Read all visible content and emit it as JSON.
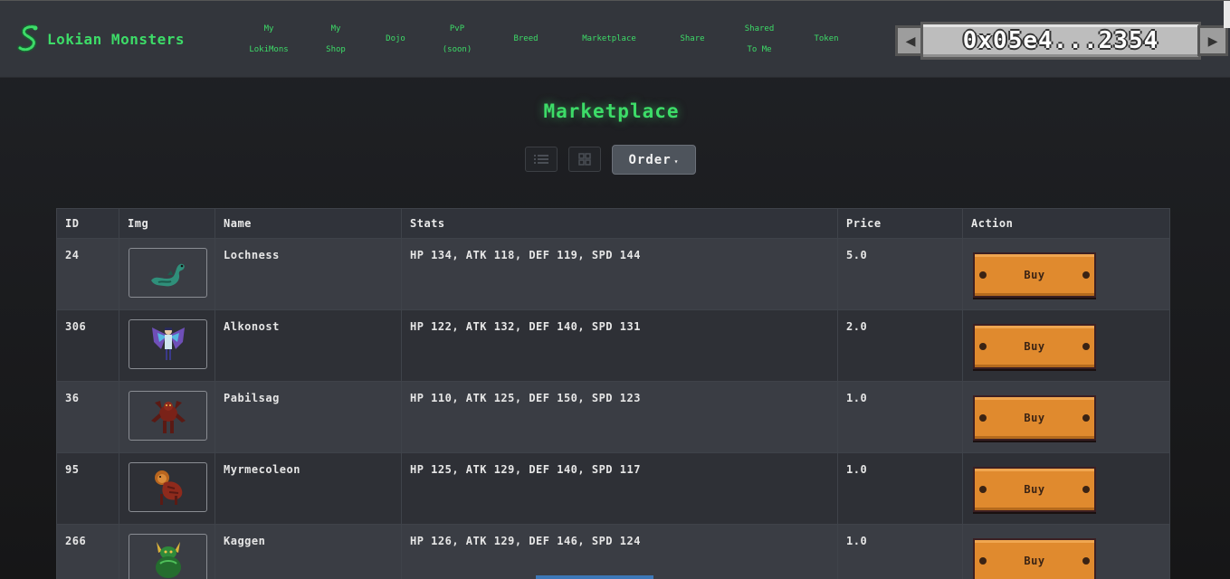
{
  "app": {
    "brand": "Lokian Monsters",
    "accent": "#3ddc68"
  },
  "nav": {
    "items": [
      {
        "lines": [
          "My",
          "LokiMons"
        ]
      },
      {
        "lines": [
          "My",
          "Shop"
        ]
      },
      {
        "lines": [
          "Dojo"
        ]
      },
      {
        "lines": [
          "PvP",
          "(soon)"
        ]
      },
      {
        "lines": [
          "Breed"
        ]
      },
      {
        "lines": [
          "Marketplace"
        ]
      },
      {
        "lines": [
          "Share"
        ]
      },
      {
        "lines": [
          "Shared",
          "To Me"
        ]
      },
      {
        "lines": [
          "Token"
        ]
      }
    ]
  },
  "wallet": {
    "address": "0x05e4...2354"
  },
  "page": {
    "title": "Marketplace",
    "order_label": "Order"
  },
  "table": {
    "headers": {
      "id": "ID",
      "img": "Img",
      "name": "Name",
      "stats": "Stats",
      "price": "Price",
      "action": "Action"
    },
    "buy_label": "Buy",
    "rows": [
      {
        "id": "24",
        "name": "Lochness",
        "stats": "HP 134, ATK 118, DEF 119, SPD 144",
        "price": "5.0",
        "icon": "sea-serpent-icon"
      },
      {
        "id": "306",
        "name": "Alkonost",
        "stats": "HP 122, ATK 132, DEF 140, SPD 131",
        "price": "2.0",
        "icon": "winged-bird-maiden-icon"
      },
      {
        "id": "36",
        "name": "Pabilsag",
        "stats": "HP 110, ATK 125, DEF 150, SPD 123",
        "price": "1.0",
        "icon": "scorpion-demon-icon"
      },
      {
        "id": "95",
        "name": "Myrmecoleon",
        "stats": "HP 125, ATK 129, DEF 140, SPD 117",
        "price": "1.0",
        "icon": "ant-lion-beast-icon"
      },
      {
        "id": "266",
        "name": "Kaggen",
        "stats": "HP 126, ATK 129, DEF 146, SPD 124",
        "price": "1.0",
        "icon": "green-horned-beast-icon"
      }
    ]
  }
}
